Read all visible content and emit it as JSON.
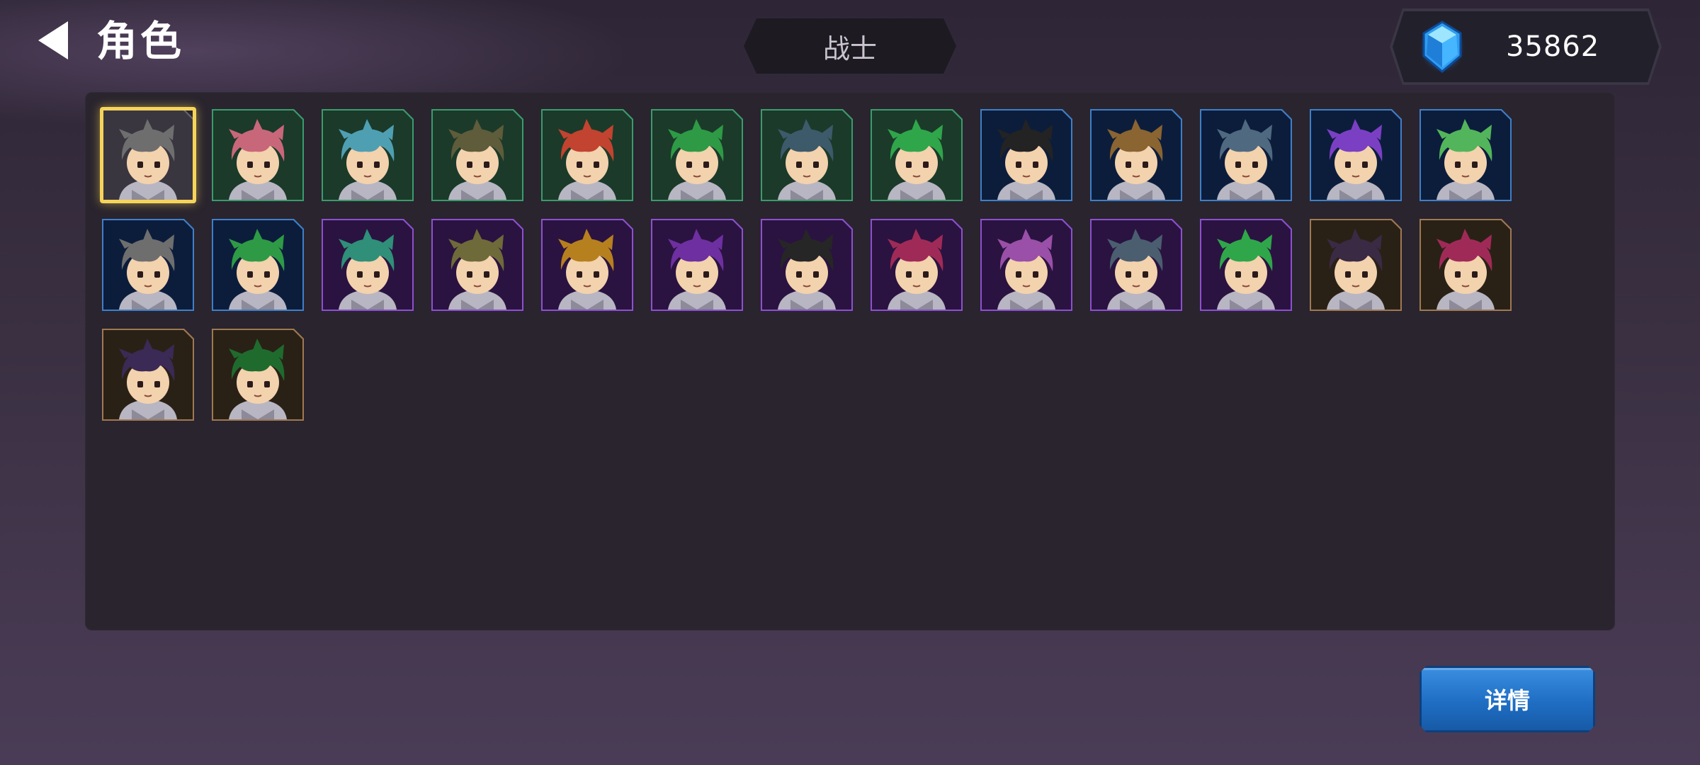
{
  "header": {
    "title": "角色",
    "back_icon": "back-arrow-icon",
    "class_tab": "战士",
    "currency": {
      "icon": "blue-gem-icon",
      "amount": "35862"
    }
  },
  "colors": {
    "green": "#3a9c6c",
    "blue": "#3f7fc8",
    "purple": "#8e4fd2",
    "orange": "#a07852",
    "gray": "#6a6470",
    "selected": "#f6d45a",
    "button": "#1f6ec4"
  },
  "roster": {
    "selected_index": 0,
    "characters": [
      {
        "rarity": "gray",
        "hair": "#6e6e6e"
      },
      {
        "rarity": "green",
        "hair": "#c9677a"
      },
      {
        "rarity": "green",
        "hair": "#4f9fb3"
      },
      {
        "rarity": "green",
        "hair": "#5e5c3a"
      },
      {
        "rarity": "green",
        "hair": "#c2432f"
      },
      {
        "rarity": "green",
        "hair": "#2e9a45"
      },
      {
        "rarity": "green",
        "hair": "#3c5a6a"
      },
      {
        "rarity": "green",
        "hair": "#2fa64a"
      },
      {
        "rarity": "blue",
        "hair": "#232323"
      },
      {
        "rarity": "blue",
        "hair": "#8a6431"
      },
      {
        "rarity": "blue",
        "hair": "#4f6a80"
      },
      {
        "rarity": "blue",
        "hair": "#7b3fc4"
      },
      {
        "rarity": "blue",
        "hair": "#53b55b"
      },
      {
        "rarity": "blue",
        "hair": "#6e6e6e"
      },
      {
        "rarity": "blue",
        "hair": "#2e9a45"
      },
      {
        "rarity": "purple",
        "hair": "#2f8f78"
      },
      {
        "rarity": "purple",
        "hair": "#6f6a3a"
      },
      {
        "rarity": "purple",
        "hair": "#b7801f"
      },
      {
        "rarity": "purple",
        "hair": "#6e2fa0"
      },
      {
        "rarity": "purple",
        "hair": "#262626"
      },
      {
        "rarity": "purple",
        "hair": "#a02a57"
      },
      {
        "rarity": "purple",
        "hair": "#9a4fa8"
      },
      {
        "rarity": "purple",
        "hair": "#4a5e70"
      },
      {
        "rarity": "purple",
        "hair": "#2fa64a"
      },
      {
        "rarity": "orange",
        "hair": "#3a2a44"
      },
      {
        "rarity": "orange",
        "hair": "#a02a57"
      },
      {
        "rarity": "orange",
        "hair": "#3a2a55"
      },
      {
        "rarity": "orange",
        "hair": "#1f6b2e"
      }
    ]
  },
  "actions": {
    "details_label": "详情"
  }
}
